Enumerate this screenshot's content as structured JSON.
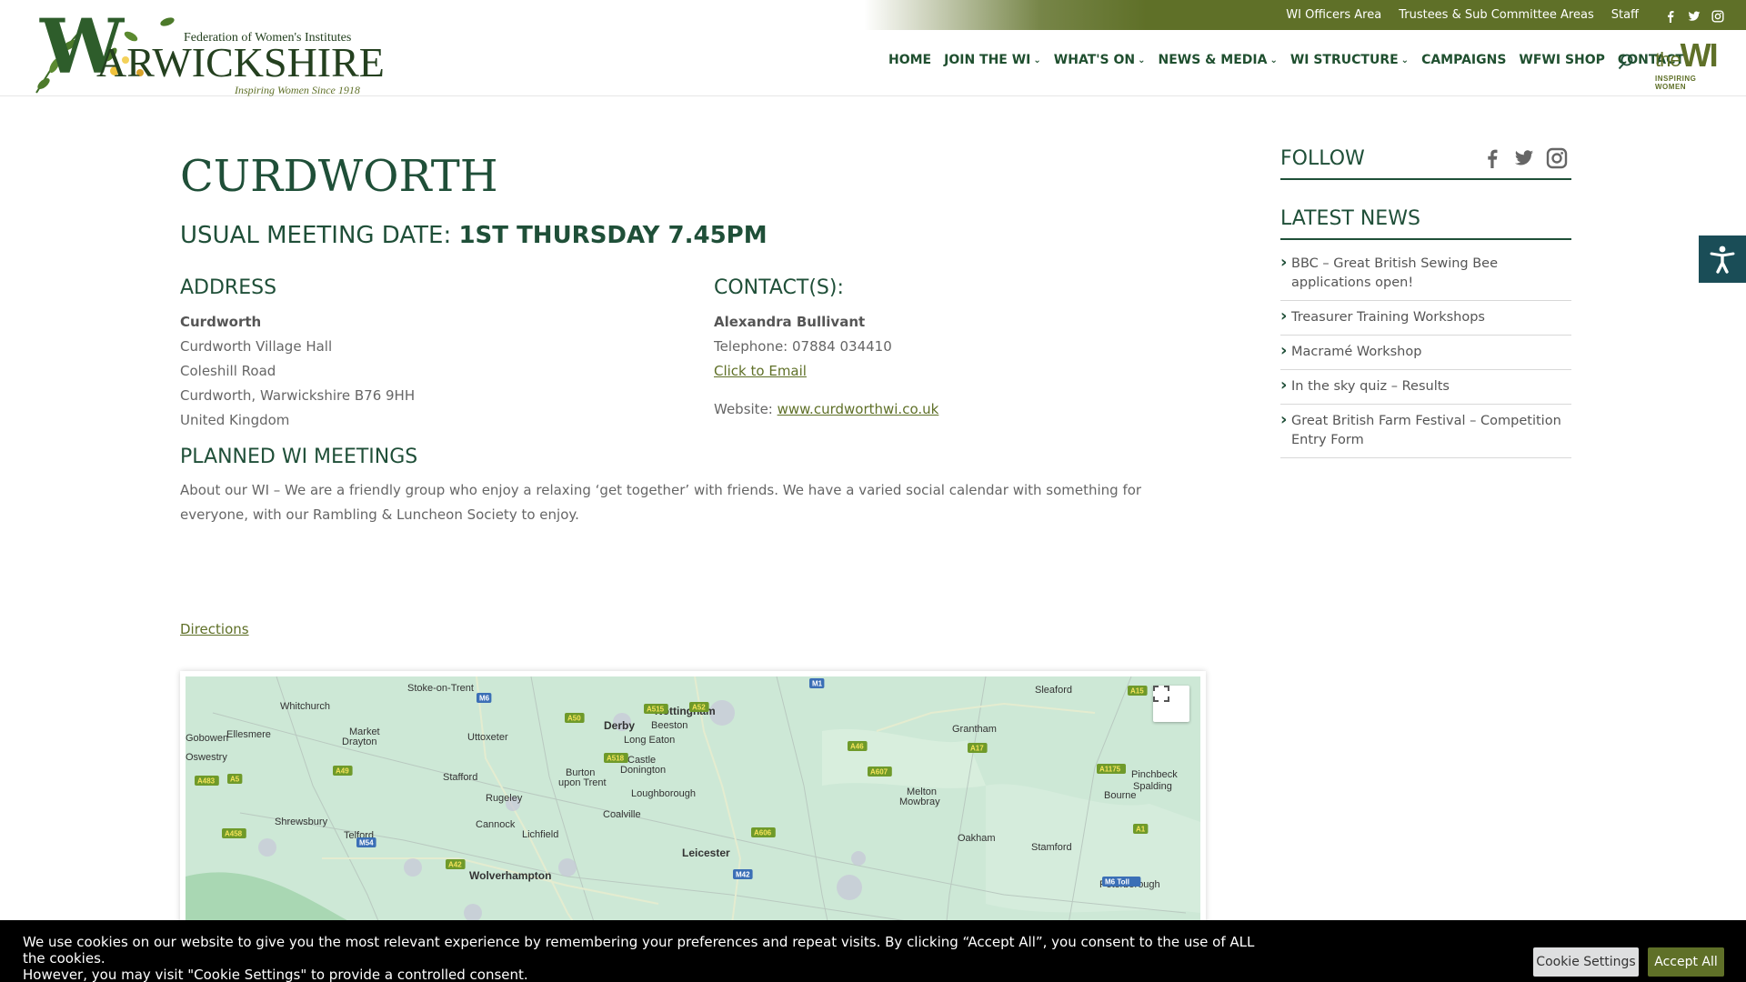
{
  "topbar": {
    "links": [
      "WI Officers Area",
      "Trustees & Sub Committee Areas",
      "Staff"
    ],
    "social": [
      "facebook-icon",
      "twitter-icon",
      "instagram-icon"
    ]
  },
  "logo": {
    "w": "W",
    "federation": "Federation of Women's Institutes",
    "name": "ARWICKSHIRE",
    "tagline": "Inspiring Women Since 1918"
  },
  "nav": {
    "items": [
      {
        "label": "HOME",
        "dropdown": false
      },
      {
        "label": "JOIN THE WI",
        "dropdown": true
      },
      {
        "label": "WHAT'S ON",
        "dropdown": true
      },
      {
        "label": "NEWS & MEDIA",
        "dropdown": true
      },
      {
        "label": "WI STRUCTURE",
        "dropdown": true
      },
      {
        "label": "CAMPAIGNS",
        "dropdown": false
      },
      {
        "label": "WFWI SHOP",
        "dropdown": false
      },
      {
        "label": "CONTACT",
        "dropdown": false
      }
    ],
    "thewi": {
      "the": "the",
      "wi": "WI",
      "sub": "INSPIRING WOMEN"
    }
  },
  "page": {
    "title": "CURDWORTH",
    "meeting_label": "USUAL MEETING DATE: ",
    "meeting_value": "1ST THURSDAY 7.45PM",
    "address_heading": "ADDRESS",
    "address": {
      "name": "Curdworth",
      "line1": "Curdworth Village Hall",
      "line2": "Coleshill Road",
      "line3": "Curdworth, Warwickshire B76 9HH",
      "line4": "United Kingdom"
    },
    "contact_heading": "CONTACT(S):",
    "contact": {
      "name": "Alexandra Bullivant",
      "telephone": "Telephone: 07884 034410",
      "email_link": "Click to Email",
      "website_label": "Website: ",
      "website_link": "www.curdworthwi.co.uk"
    },
    "planned_heading": "PLANNED WI MEETINGS",
    "about": "About our WI – We are a friendly group who enjoy a relaxing ‘get together’ with friends. We have a varied social calendar with something for everyone, with our Rambling & Luncheon Society to enjoy.",
    "directions": "Directions"
  },
  "map": {
    "places": [
      "Stoke-on-Trent",
      "Whitchurch",
      "Ellesmere",
      "Gobowen",
      "Oswestry",
      "Market Drayton",
      "Uttoxeter",
      "Derby",
      "Nottingham",
      "Beeston",
      "Long Eaton",
      "Sleaford",
      "Grantham",
      "Stafford",
      "Burton upon Trent",
      "Castle Donington",
      "Loughborough",
      "Melton Mowbray",
      "Rugeley",
      "Shrewsbury",
      "Telford",
      "Cannock",
      "Lichfield",
      "Coalville",
      "Leicester",
      "Oakham",
      "Stamford",
      "Bourne",
      "Pinchbeck",
      "Spalding",
      "Wolverhampton",
      "Peterborough"
    ],
    "roads": [
      "M6",
      "M1",
      "A52",
      "A515",
      "A50",
      "A518",
      "A49",
      "A483",
      "A5",
      "A458",
      "M54",
      "A42",
      "A606",
      "A46",
      "A607",
      "A17",
      "A15",
      "A1175",
      "A1",
      "M6 Toll",
      "M42"
    ]
  },
  "sidebar": {
    "follow_label": "FOLLOW",
    "latest_label": "LATEST NEWS",
    "news": [
      "BBC – Great British Sewing Bee applications open!",
      "Treasurer Training Workshops",
      "Macramé Workshop",
      "In the sky quiz – Results",
      "Great British Farm Festival – Competition Entry Form"
    ]
  },
  "cookie": {
    "line1": "We use cookies on our website to give you the most relevant experience by remembering your preferences and repeat visits. By clicking “Accept All”, you consent to the use of ALL the cookies.",
    "line2": "However, you may visit \"Cookie Settings\" to provide a controlled consent.",
    "settings_label": "Cookie Settings",
    "accept_label": "Accept All"
  },
  "colors": {
    "brand_green": "#1f4f38",
    "olive": "#5f7028",
    "accessibility": "#1a4d57"
  }
}
